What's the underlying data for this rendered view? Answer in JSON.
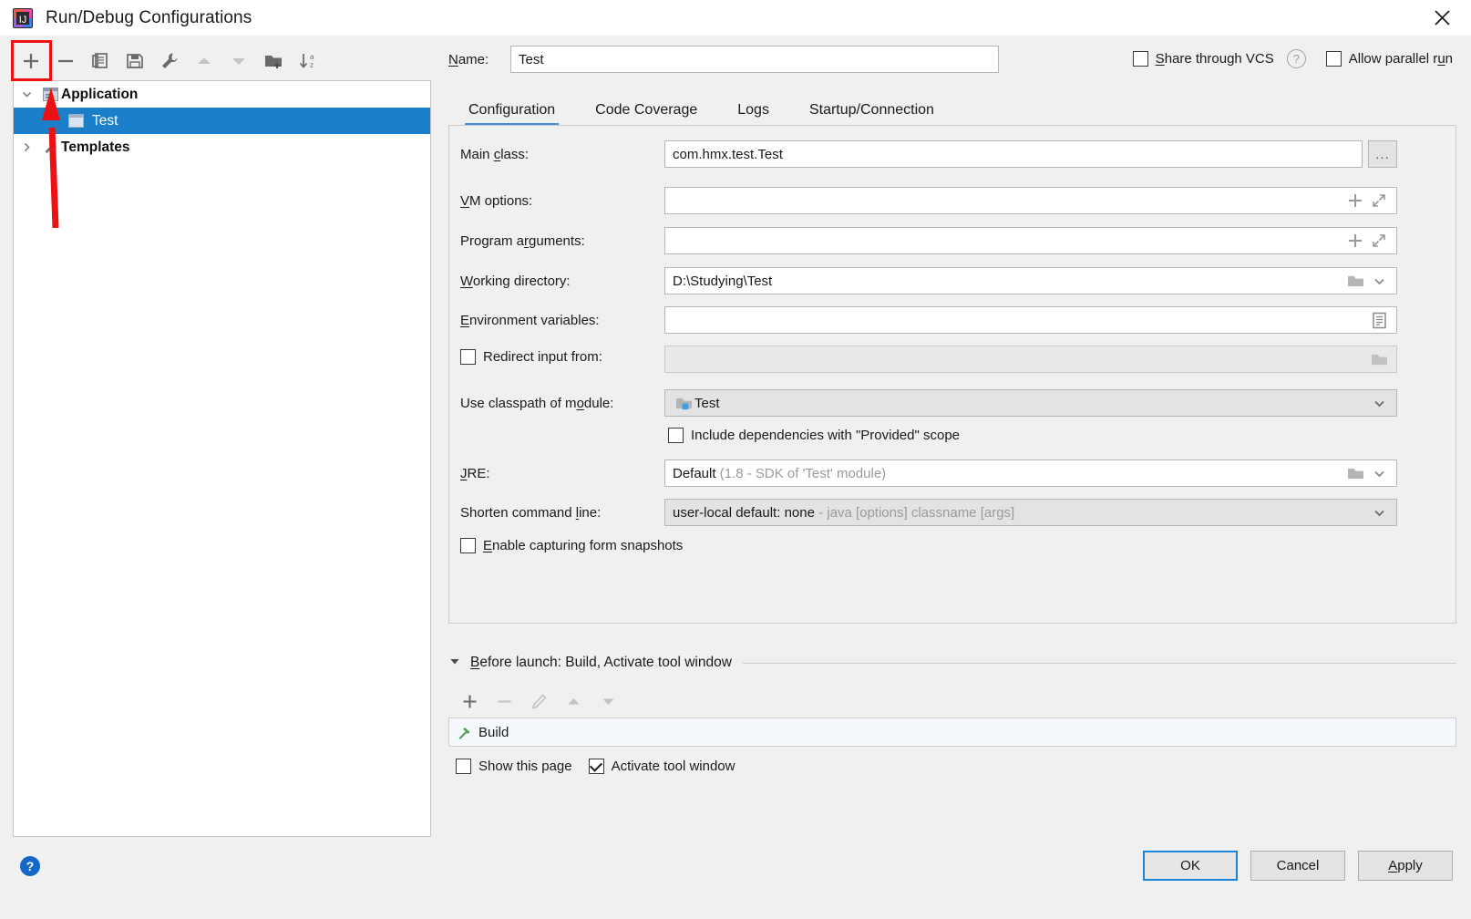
{
  "window": {
    "title": "Run/Debug Configurations",
    "logo_icon": "intellij-idea-logo",
    "close_icon": "close-icon"
  },
  "left_toolbar": {
    "buttons": [
      {
        "name": "add-configuration-button",
        "icon": "plus-icon",
        "tooltip": "Add New Configuration",
        "enabled": true,
        "highlighted": true
      },
      {
        "name": "remove-configuration-button",
        "icon": "minus-icon",
        "tooltip": "Remove Configuration",
        "enabled": true
      },
      {
        "name": "copy-configuration-button",
        "icon": "copy-icon",
        "tooltip": "Copy Configuration",
        "enabled": true
      },
      {
        "name": "save-configuration-button",
        "icon": "save-icon",
        "tooltip": "Save Configuration",
        "enabled": true
      },
      {
        "name": "edit-templates-button",
        "icon": "wrench-icon",
        "tooltip": "Edit Templates",
        "enabled": true
      },
      {
        "name": "move-up-button",
        "icon": "arrow-up-icon",
        "tooltip": "Move Up",
        "enabled": false
      },
      {
        "name": "move-down-button",
        "icon": "arrow-down-icon",
        "tooltip": "Move Down",
        "enabled": false
      },
      {
        "name": "create-folder-button",
        "icon": "folder-add-icon",
        "tooltip": "Create New Folder",
        "enabled": true
      },
      {
        "name": "sort-configurations-button",
        "icon": "sort-az-icon",
        "tooltip": "Sort Configurations",
        "enabled": true
      }
    ]
  },
  "tree": {
    "nodes": [
      {
        "label": "Application",
        "icon": "application-icon",
        "toggle": "chevron-down-icon",
        "level": 0,
        "selected": false
      },
      {
        "label": "Test",
        "icon": "configuration-icon",
        "toggle": "",
        "level": 1,
        "selected": true
      },
      {
        "label": "Templates",
        "icon": "wrench-icon",
        "toggle": "chevron-right-icon",
        "level": 0,
        "selected": false
      }
    ]
  },
  "name_field": {
    "label": "Name:",
    "label_mnemonic": "N",
    "value": "Test",
    "placeholder": ""
  },
  "top_options": {
    "share_vcs": {
      "label": "Share through VCS",
      "label_mnemonic": "S",
      "checked": false
    },
    "help_icon": "help-icon",
    "allow_parallel": {
      "label": "Allow parallel run",
      "label_mnemonic": "u",
      "checked": false
    }
  },
  "tabs": [
    {
      "label": "Configuration",
      "active": true
    },
    {
      "label": "Code Coverage",
      "active": false
    },
    {
      "label": "Logs",
      "active": false
    },
    {
      "label": "Startup/Connection",
      "active": false
    }
  ],
  "configuration": {
    "main_class": {
      "label": "Main class:",
      "mnemonic": "c",
      "value": "com.hmx.test.Test",
      "browse_button_label": "...",
      "browse_icon": "ellipsis-icon"
    },
    "vm_options": {
      "label": "VM options:",
      "mnemonic": "V",
      "value": "",
      "icons": [
        "plus-icon",
        "expand-icon"
      ]
    },
    "program_arguments": {
      "label": "Program arguments:",
      "mnemonic": "r",
      "value": "",
      "icons": [
        "plus-icon",
        "expand-icon"
      ]
    },
    "working_directory": {
      "label": "Working directory:",
      "mnemonic": "W",
      "value": "D:\\Studying\\Test",
      "icons": [
        "folder-icon",
        "chevron-down-icon"
      ]
    },
    "environment_variables": {
      "label": "Environment variables:",
      "mnemonic": "E",
      "value": "",
      "icons": [
        "list-icon"
      ]
    },
    "redirect_input": {
      "label": "Redirect input from:",
      "checked": false,
      "value": "",
      "disabled": true,
      "icons": [
        "folder-icon"
      ]
    },
    "classpath_module": {
      "label": "Use classpath of module:",
      "mnemonic": "o",
      "value": "Test",
      "value_icon": "module-icon",
      "icons": [
        "chevron-down-icon"
      ]
    },
    "include_provided": {
      "label": "Include dependencies with \"Provided\" scope",
      "checked": false
    },
    "jre": {
      "label": "JRE:",
      "mnemonic": "J",
      "value": "Default",
      "value_hint": "(1.8 - SDK of 'Test' module)",
      "icons": [
        "folder-icon",
        "chevron-down-icon"
      ]
    },
    "shorten_command_line": {
      "label": "Shorten command line:",
      "mnemonic": "l",
      "value": "user-local default: none",
      "value_hint": "- java [options] classname [args]",
      "icons": [
        "chevron-down-icon"
      ]
    },
    "form_snapshots": {
      "label": "Enable capturing form snapshots",
      "mnemonic": "E",
      "checked": false
    }
  },
  "before_launch": {
    "toggle_icon": "triangle-down-icon",
    "title": "Before launch: Build, Activate tool window",
    "title_mnemonic": "B",
    "toolbar": [
      {
        "name": "add-task-button",
        "icon": "plus-icon",
        "enabled": true
      },
      {
        "name": "remove-task-button",
        "icon": "minus-icon",
        "enabled": false
      },
      {
        "name": "edit-task-button",
        "icon": "pencil-icon",
        "enabled": false
      },
      {
        "name": "task-move-up-button",
        "icon": "arrow-up-icon",
        "enabled": false
      },
      {
        "name": "task-move-down-button",
        "icon": "arrow-down-icon",
        "enabled": false
      }
    ],
    "items": [
      {
        "label": "Build",
        "icon": "hammer-icon"
      }
    ],
    "show_this_page": {
      "label": "Show this page",
      "checked": false
    },
    "activate_tool_window": {
      "label": "Activate tool window",
      "checked": true
    }
  },
  "footer": {
    "help_icon": "help-icon",
    "help_glyph": "?",
    "buttons": [
      {
        "label": "OK",
        "name": "ok-button",
        "primary": true
      },
      {
        "label": "Cancel",
        "name": "cancel-button",
        "primary": false
      },
      {
        "label": "Apply",
        "name": "apply-button",
        "primary": false,
        "mnemonic": "A"
      }
    ]
  },
  "annotation": {
    "color": "#ee1111",
    "shape": "arrow-pointing-to-add-button"
  },
  "colors": {
    "selection_blue": "#1a7ec8",
    "tab_accent": "#3f8fd6",
    "panel_bg": "#f0f0f0",
    "field_bg": "#ffffff",
    "help_blue": "#1168c8",
    "annotation_red": "#ee1111",
    "hammer_green": "#56a056"
  }
}
